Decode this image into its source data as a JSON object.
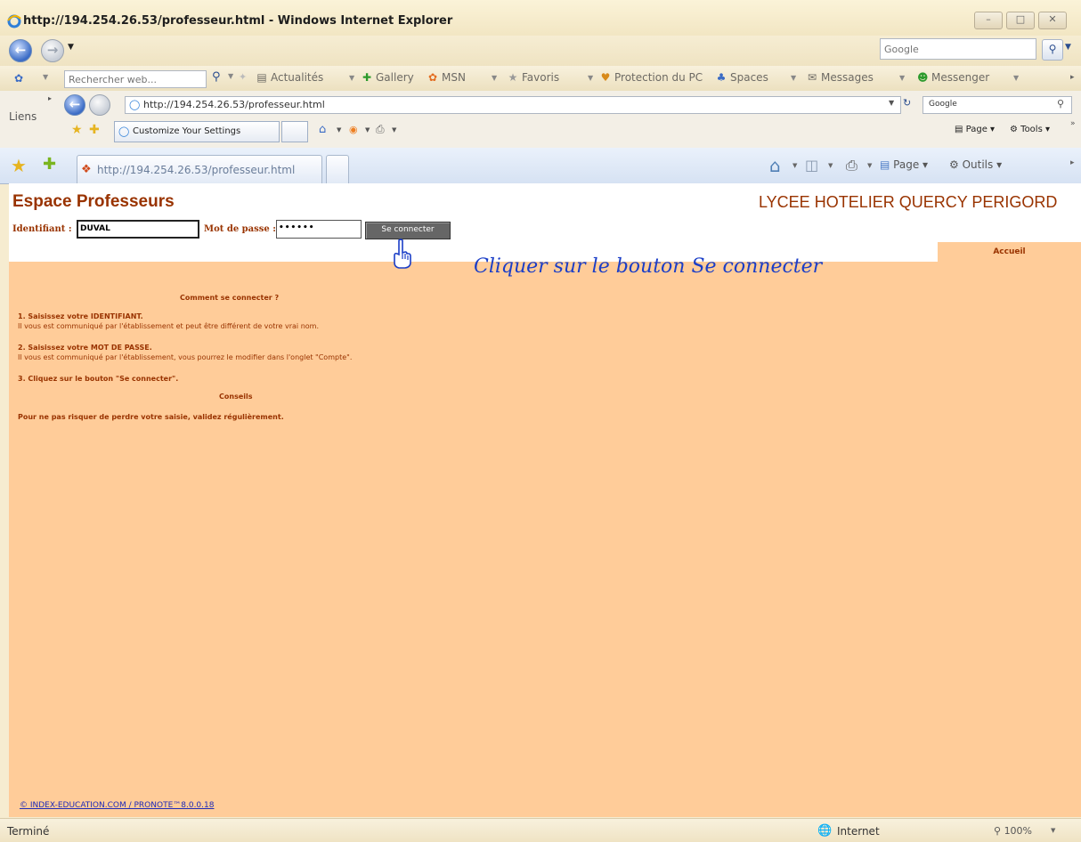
{
  "window": {
    "title": "http://194.254.26.53/professeur.html - Windows Internet Explorer"
  },
  "nav": {
    "search_placeholder": "Google"
  },
  "msn_toolbar": {
    "search_placeholder": "Rechercher web...",
    "items": [
      "Actualités",
      "Gallery",
      "MSN",
      "Favoris",
      "Protection du PC",
      "Spaces",
      "Messages",
      "Messenger"
    ]
  },
  "links_label": "Liens",
  "inner": {
    "address": "http://194.254.26.53/professeur.html",
    "search": "Google",
    "tab_label": "Customize Your Settings",
    "page_menu": "Page",
    "tools_menu": "Tools"
  },
  "tabs": {
    "active_label": "http://194.254.26.53/professeur.html",
    "page_menu": "Page",
    "tools_menu": "Outils"
  },
  "page": {
    "title": "Espace Professeurs",
    "school": "LYCEE HOTELIER QUERCY PERIGORD",
    "identifiant_label": "Identifiant :",
    "identifiant_value": "DUVAL",
    "password_label": "Mot de passe :",
    "password_value": "••••••",
    "connect_button": "Se connecter",
    "accueil": "Accueil",
    "annotation": "Cliquer sur le bouton Se connecter",
    "help_title": "Comment se connecter ?",
    "step1_title": "1. Saisissez votre IDENTIFIANT.",
    "step1_text": "Il vous est communiqué par l'établissement et peut être différent de votre vrai nom.",
    "step2_title": "2. Saisissez votre MOT DE PASSE.",
    "step2_text": "Il vous est communiqué par l'établissement, vous pourrez le modifier dans l'onglet \"Compte\".",
    "step3_title": "3. Cliquez sur le bouton \"Se connecter\".",
    "conseils_title": "Conseils",
    "conseils_text": "Pour ne pas risquer de perdre votre saisie, validez régulièrement.",
    "footer_link": "© INDEX-EDUCATION.COM / PRONOTE™8.0.0.18"
  },
  "status": {
    "left": "Terminé",
    "zone": "Internet",
    "zoom": "100%"
  }
}
